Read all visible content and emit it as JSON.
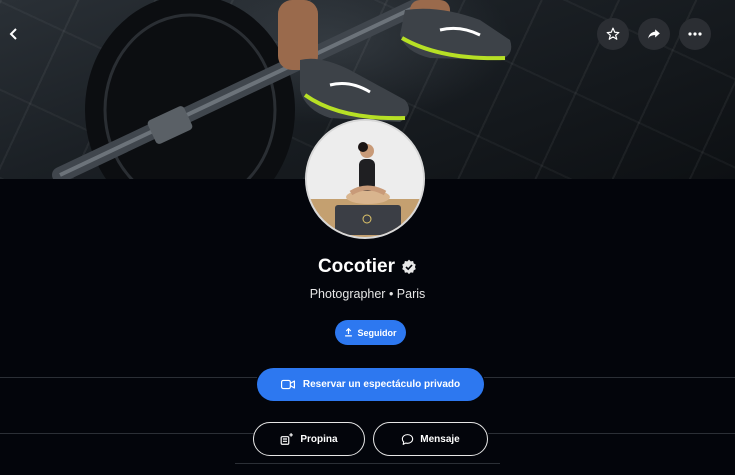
{
  "profile": {
    "name": "Cocotier",
    "verified": true,
    "subtitle": "Photographer • Paris"
  },
  "actions": {
    "follow_label": "Seguidor",
    "book_label": "Reservar un espectáculo privado",
    "tip_label": "Propina",
    "message_label": "Mensaje"
  },
  "header_icons": [
    "back-icon",
    "star-icon",
    "share-icon",
    "more-icon"
  ],
  "colors": {
    "background": "#03050b",
    "accent": "#2d78f0",
    "icon_button": "#2b2e33"
  }
}
